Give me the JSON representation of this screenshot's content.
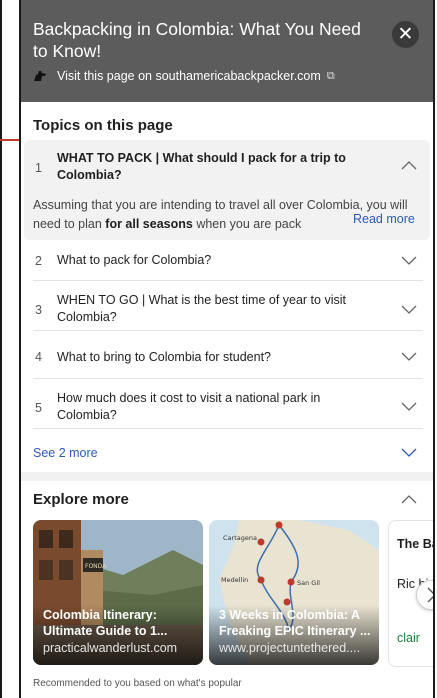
{
  "header": {
    "title": "Backpacking in Colombia: What You Need to Know!",
    "visit_text": "Visit this page on southamericabackpacker.com",
    "site_icon": "llama-icon",
    "close_icon": "close-icon"
  },
  "topics": {
    "title": "Topics on this page",
    "items": [
      {
        "num": "1",
        "label": "WHAT TO PACK | What should I pack for a trip to Colombia?",
        "expanded": true
      },
      {
        "num": "2",
        "label": "What to pack for Colombia?"
      },
      {
        "num": "3",
        "label": "WHEN TO GO | What is the best time of year to visit Colombia?"
      },
      {
        "num": "4",
        "label": "What to bring to Colombia for student?"
      },
      {
        "num": "5",
        "label": "How much does it cost to visit a national park in Colombia?"
      }
    ],
    "answer_part1": "Assuming that you are intending to travel all over Colombia, you will need to plan ",
    "answer_bold": "for all seasons",
    "answer_part2": " when you are pack",
    "read_more": "Read more",
    "see_more": "See 2 more"
  },
  "explore": {
    "title": "Explore more",
    "cards": [
      {
        "title": "Colombia Itinerary: Ultimate Guide to 1...",
        "source": "practicalwanderlust.com"
      },
      {
        "title": "3 Weeks in Colombia: A Freaking EPIC Itinerary ...",
        "source": "www.projectuntethered...."
      },
      {
        "title": "The Bac",
        "desc": "Ric big shar",
        "source": "clair"
      }
    ],
    "map_labels": [
      "Cartagena",
      "Medellin",
      "San Gil"
    ],
    "sign_text": "FONDA"
  },
  "footer": {
    "note": "Recommended to you based on what's popular"
  }
}
